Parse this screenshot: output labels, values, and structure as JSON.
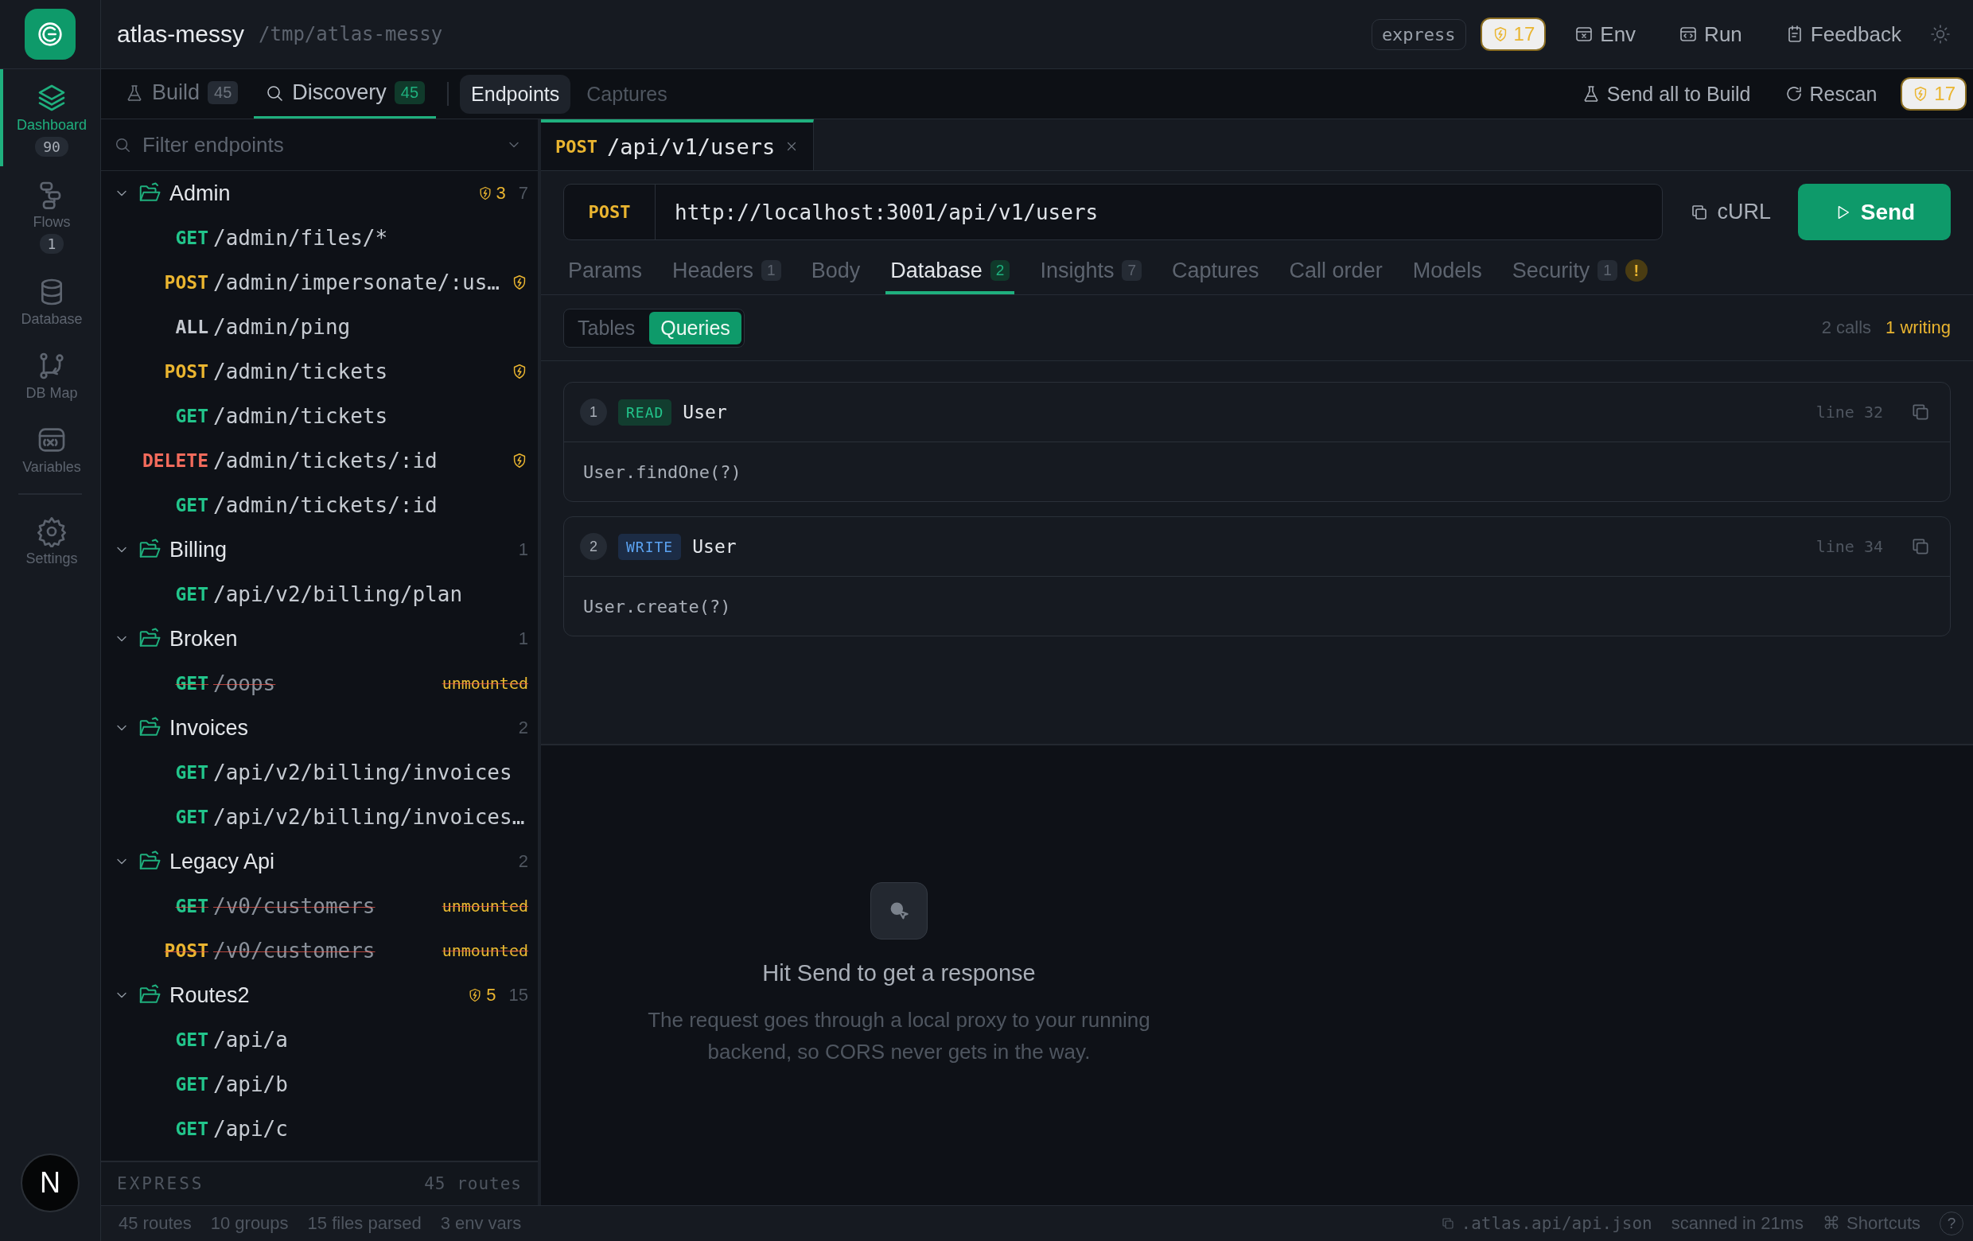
{
  "rail": {
    "items": [
      {
        "kind": "layers",
        "label": "Dashboard",
        "count": "90",
        "selected": true
      },
      {
        "kind": "flows",
        "label": "Flows",
        "count": "1",
        "selected": false
      },
      {
        "kind": "database",
        "label": "Database",
        "selected": false
      },
      {
        "kind": "dbmap",
        "label": "DB Map",
        "selected": false
      },
      {
        "kind": "variables",
        "label": "Variables",
        "selected": false
      },
      {
        "kind": "settings",
        "label": "Settings",
        "selected": false
      }
    ],
    "avatar": "N"
  },
  "project": {
    "name": "atlas-messy",
    "path": "/tmp/atlas-messy"
  },
  "header": {
    "framework": "express",
    "warnings": "17",
    "actions": [
      {
        "kind": "env",
        "label": "Env"
      },
      {
        "kind": "run",
        "label": "Run"
      },
      {
        "kind": "feedback",
        "label": "Feedback"
      }
    ]
  },
  "nav": {
    "tabs": [
      {
        "kind": "build",
        "label": "Build",
        "count": "45",
        "selected": false
      },
      {
        "kind": "discovery",
        "label": "Discovery",
        "count": "45",
        "selected": true
      }
    ],
    "views": [
      {
        "label": "Endpoints",
        "selected": true
      },
      {
        "label": "Captures",
        "selected": false
      }
    ],
    "actions": [
      {
        "kind": "build",
        "label": "Send all to Build"
      },
      {
        "kind": "rescan",
        "label": "Rescan"
      }
    ],
    "warnings": "17"
  },
  "tree": {
    "placeholder": "Filter endpoints",
    "groups": [
      {
        "name": "Admin",
        "expanded": true,
        "warnings": "3",
        "count": "7",
        "routes": [
          {
            "method": "GET",
            "color": "#22c58b",
            "path": "/admin/files/*",
            "flagged": false,
            "mounted": true
          },
          {
            "method": "POST",
            "color": "#eab530",
            "path": "/admin/impersonate/:us…",
            "flagged": true,
            "mounted": true
          },
          {
            "method": "ALL",
            "color": "#c3c7ce",
            "path": "/admin/ping",
            "flagged": false,
            "mounted": true
          },
          {
            "method": "POST",
            "color": "#eab530",
            "path": "/admin/tickets",
            "flagged": true,
            "mounted": true
          },
          {
            "method": "GET",
            "color": "#22c58b",
            "path": "/admin/tickets",
            "flagged": false,
            "mounted": true
          },
          {
            "method": "DELETE",
            "color": "#f36b5c",
            "path": "/admin/tickets/:id",
            "flagged": true,
            "mounted": true
          },
          {
            "method": "GET",
            "color": "#22c58b",
            "path": "/admin/tickets/:id",
            "flagged": false,
            "mounted": true
          }
        ]
      },
      {
        "name": "Billing",
        "expanded": true,
        "count": "1",
        "routes": [
          {
            "method": "GET",
            "color": "#22c58b",
            "path": "/api/v2/billing/plan",
            "flagged": false,
            "mounted": true
          }
        ]
      },
      {
        "name": "Broken",
        "expanded": true,
        "count": "1",
        "routes": [
          {
            "method": "GET",
            "color": "#22c58b",
            "path": "/oops",
            "flagged": false,
            "mounted": false,
            "tag": "unmounted"
          }
        ]
      },
      {
        "name": "Invoices",
        "expanded": true,
        "count": "2",
        "routes": [
          {
            "method": "GET",
            "color": "#22c58b",
            "path": "/api/v2/billing/invoices",
            "flagged": false,
            "mounted": true
          },
          {
            "method": "GET",
            "color": "#22c58b",
            "path": "/api/v2/billing/invoices…",
            "flagged": false,
            "mounted": true
          }
        ]
      },
      {
        "name": "Legacy Api",
        "expanded": true,
        "count": "2",
        "routes": [
          {
            "method": "GET",
            "color": "#22c58b",
            "path": "/v0/customers",
            "flagged": false,
            "mounted": false,
            "tag": "unmounted"
          },
          {
            "method": "POST",
            "color": "#eab530",
            "path": "/v0/customers",
            "flagged": false,
            "mounted": false,
            "tag": "unmounted"
          }
        ]
      },
      {
        "name": "Routes2",
        "expanded": true,
        "warnings": "5",
        "count": "15",
        "routes": [
          {
            "method": "GET",
            "color": "#22c58b",
            "path": "/api/a",
            "flagged": false,
            "mounted": true
          },
          {
            "method": "GET",
            "color": "#22c58b",
            "path": "/api/b",
            "flagged": false,
            "mounted": true
          },
          {
            "method": "GET",
            "color": "#22c58b",
            "path": "/api/c",
            "flagged": false,
            "mounted": true
          }
        ]
      }
    ],
    "footer": {
      "framework": "EXPRESS",
      "routes": "45 routes"
    }
  },
  "request": {
    "tab": {
      "method": "POST",
      "path": "/api/v1/users"
    },
    "method": "POST",
    "url": "http://localhost:3001/api/v1/users",
    "curl": "cURL",
    "send": "Send",
    "tabs": [
      {
        "label": "Params",
        "selected": false
      },
      {
        "label": "Headers",
        "count": "1",
        "selected": false
      },
      {
        "label": "Body",
        "selected": false
      },
      {
        "label": "Database",
        "count": "2",
        "selected": true
      },
      {
        "label": "Insights",
        "count": "7",
        "selected": false
      },
      {
        "label": "Captures",
        "selected": false
      },
      {
        "label": "Call order",
        "selected": false
      },
      {
        "label": "Models",
        "selected": false
      },
      {
        "label": "Security",
        "count": "1",
        "alert": "!",
        "selected": false
      }
    ],
    "segments": [
      {
        "label": "Tables",
        "selected": false
      },
      {
        "label": "Queries",
        "selected": true
      }
    ],
    "calls": "2 calls",
    "writing": "1 writing",
    "queries": [
      {
        "index": "1",
        "kind": "read",
        "op": "READ",
        "model": "User",
        "line": "line 32",
        "code": "User.findOne(?)"
      },
      {
        "index": "2",
        "kind": "write",
        "op": "WRITE",
        "model": "User",
        "line": "line 34",
        "code": "User.create(?)"
      }
    ]
  },
  "response": {
    "title": "Hit Send to get a response",
    "text": "The request goes through a local proxy to your running backend, so CORS never gets in the way."
  },
  "status_bar": {
    "stats": [
      "45 routes",
      "10 groups",
      "15 files parsed",
      "3 env vars"
    ],
    "file": ".atlas.api/api.json",
    "scanned": "scanned in 21ms",
    "shortcut_glyph": "⌘",
    "shortcuts": "Shortcuts",
    "help": "?"
  }
}
